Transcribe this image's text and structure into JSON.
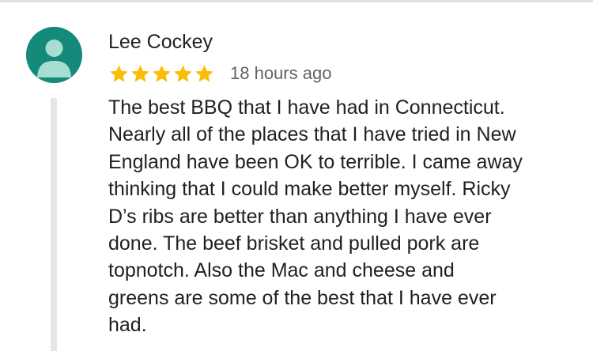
{
  "review": {
    "reviewer_name": "Lee Cockey",
    "rating": 5,
    "rating_max": 5,
    "time_ago": "18 hours ago",
    "lines": [
      "The best BBQ that I have had in Connecticut.",
      "Nearly all of the places that I have tried in New",
      "England have been OK to terrible. I came away",
      "thinking that I could make better myself. Ricky",
      "D’s ribs are better than anything I have ever",
      "done. The beef brisket and pulled pork are",
      "topnotch. Also the Mac and cheese and",
      "greens are some of the best that I have ever",
      "had."
    ]
  },
  "colors": {
    "star": "#fbbc04",
    "avatar_bg": "#148a7a",
    "avatar_figure": "#a8ddd4",
    "name_text": "#202124",
    "secondary_text": "#5f6368",
    "thread_line": "#e6e6e6"
  },
  "icons": {
    "avatar": "person-silhouette-icon",
    "rating": "star-icon"
  }
}
